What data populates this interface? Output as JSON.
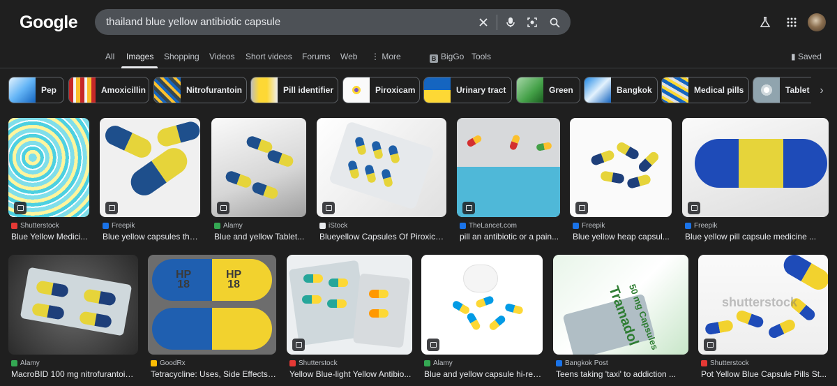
{
  "header": {
    "logo": "Google",
    "query": "thailand blue yellow antibiotic capsule"
  },
  "tabs": [
    {
      "label": "All"
    },
    {
      "label": "Images"
    },
    {
      "label": "Shopping"
    },
    {
      "label": "Videos"
    },
    {
      "label": "Short videos"
    },
    {
      "label": "Forums"
    },
    {
      "label": "Web"
    },
    {
      "label": "More"
    },
    {
      "label": "BigGo"
    },
    {
      "label": "Tools"
    },
    {
      "label": "Saved"
    }
  ],
  "chips": [
    {
      "label": "Pep"
    },
    {
      "label": "Amoxicillin"
    },
    {
      "label": "Nitrofurantoin"
    },
    {
      "label": "Pill identifier"
    },
    {
      "label": "Piroxicam"
    },
    {
      "label": "Urinary tract"
    },
    {
      "label": "Green"
    },
    {
      "label": "Bangkok"
    },
    {
      "label": "Medical pills"
    },
    {
      "label": "Tablet"
    }
  ],
  "results": [
    {
      "source": "Shutterstock",
      "title": "Blue Yellow Medici...",
      "favicon_color": "#e53935"
    },
    {
      "source": "Freepik",
      "title": "Blue yellow capsules the...",
      "favicon_color": "#1a73e8"
    },
    {
      "source": "Alamy",
      "title": "Blue and yellow Tablet...",
      "favicon_color": "#34a853"
    },
    {
      "source": "iStock",
      "title": "Blueyellow Capsules Of Piroxica...",
      "favicon_color": "#e8eaed"
    },
    {
      "source": "TheLancet.com",
      "title": "pill an antibiotic or a pain...",
      "favicon_color": "#1a73e8"
    },
    {
      "source": "Freepik",
      "title": "Blue yellow heap capsul...",
      "favicon_color": "#1a73e8"
    },
    {
      "source": "Freepik",
      "title": "Blue yellow pill capsule medicine ...",
      "favicon_color": "#1a73e8"
    },
    {
      "source": "Alamy",
      "title": "MacroBID 100 mg nitrofurantoin ...",
      "favicon_color": "#34a853"
    },
    {
      "source": "GoodRx",
      "title": "Tetracycline: Uses, Side Effects ...",
      "favicon_color": "#fbbc04"
    },
    {
      "source": "Shutterstock",
      "title": "Yellow Blue-light Yellow Antibio...",
      "favicon_color": "#e53935"
    },
    {
      "source": "Alamy",
      "title": "Blue and yellow capsule hi-res...",
      "favicon_color": "#34a853"
    },
    {
      "source": "Bangkok Post",
      "title": "Teens taking 'taxi' to addiction ...",
      "favicon_color": "#1a73e8"
    },
    {
      "source": "Shutterstock",
      "title": "Pot Yellow Blue Capsule Pills St...",
      "favicon_color": "#e53935"
    }
  ],
  "image_text": {
    "hp18_a": "HP",
    "hp18_b": "18",
    "hp18_c": "HP",
    "hp18_d": "18",
    "tramadol": "Tramadol",
    "tramadol_dose": "50 mg Capsules",
    "watermark": "shutterstock"
  }
}
